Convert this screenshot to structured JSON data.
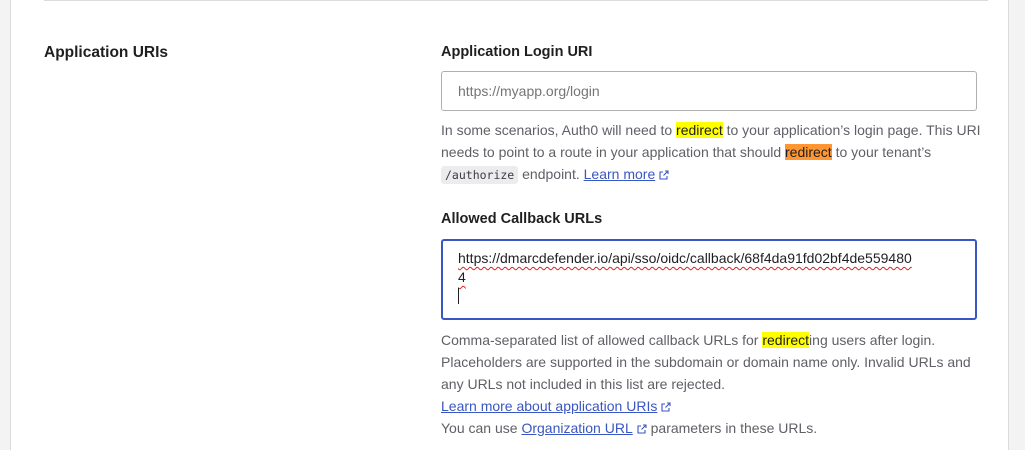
{
  "section": {
    "title": "Application URIs"
  },
  "login_uri": {
    "label": "Application Login URI",
    "placeholder": "https://myapp.org/login",
    "help_a": "In some scenarios, Auth0 will need to ",
    "help_hl1": "redirect",
    "help_b": " to your application’s login page. This URI needs to point to a route in your application that should ",
    "help_hl2": "redirect",
    "help_c": " to your tenant’s ",
    "help_code": "/authorize",
    "help_d": " endpoint. ",
    "learn_more": "Learn more"
  },
  "callback": {
    "label": "Allowed Callback URLs",
    "value_line1": "https://dmarcdefender.io/api/sso/oidc/callback/68f4da91fd02bf4de559480",
    "value_line2": "4",
    "help_a": "Comma-separated list of allowed callback URLs for ",
    "help_hl": "redirect",
    "help_b": "ing users after login. Placeholders are supported in the subdomain or domain name only. Invalid URLs and any URLs not included in this list are rejected.",
    "learn_more": "Learn more about application URIs",
    "org_a": "You can use ",
    "org_link": "Organization URL",
    "org_b": " parameters in these URLs."
  },
  "colors": {
    "link": "#3a56c2",
    "focus_border": "#3a56c2",
    "highlight_yellow": "#ffff00",
    "highlight_orange": "#ff9632"
  }
}
